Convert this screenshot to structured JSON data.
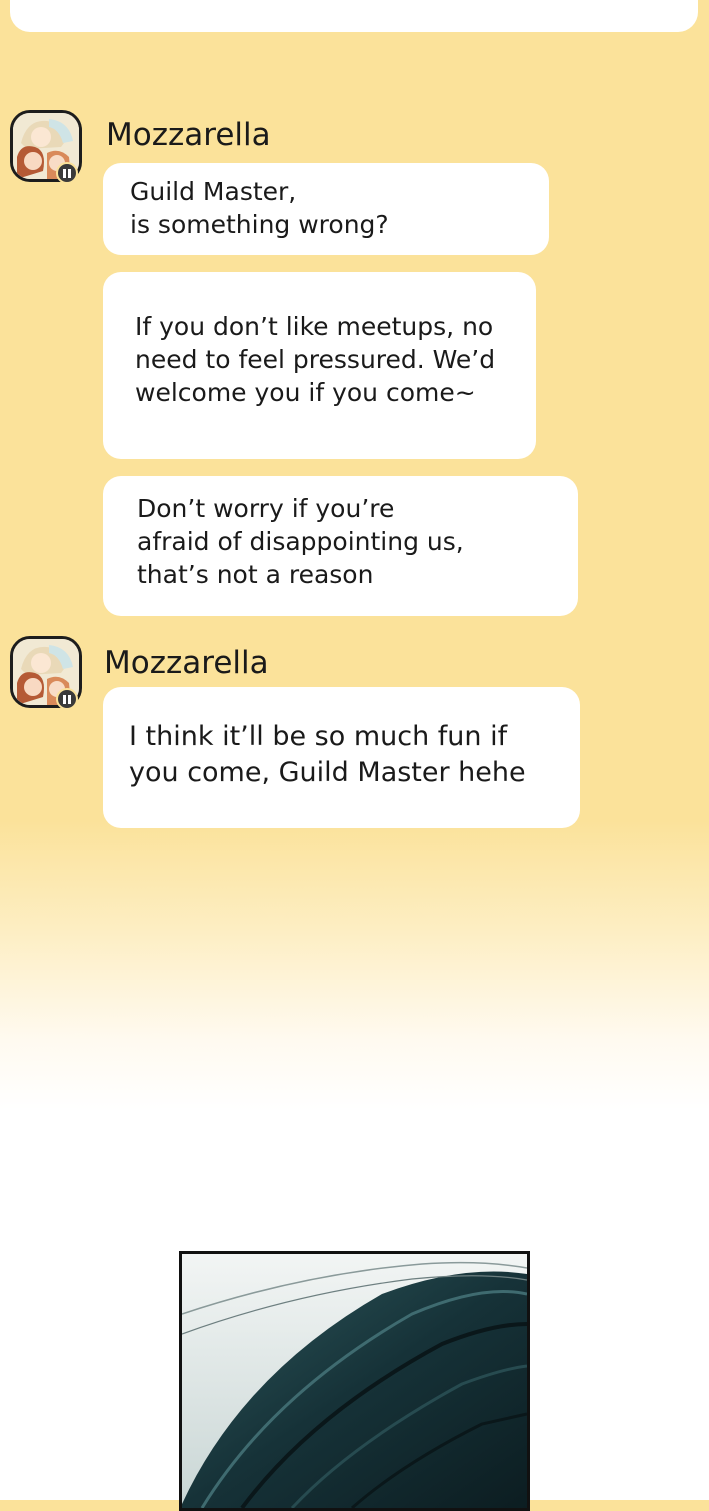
{
  "conversation": {
    "groups": [
      {
        "sender": "Mozzarella",
        "avatar_icon": "character-avatar-icon",
        "messages": [
          "Guild Master,\nis something wrong?",
          "If you don’t like meetups, no\nneed to feel pressured. We’d\nwelcome you if you come~",
          "Don’t worry if you’re\nafraid of disappointing us,\nthat’s not a reason"
        ]
      },
      {
        "sender": "Mozzarella",
        "avatar_icon": "character-avatar-icon",
        "messages": [
          "I think it’ll be so much fun if\nyou come, Guild Master hehe"
        ]
      }
    ]
  },
  "colors": {
    "background_top": "#fbe29a",
    "bubble": "#ffffff",
    "panel_dark": "#163238"
  }
}
